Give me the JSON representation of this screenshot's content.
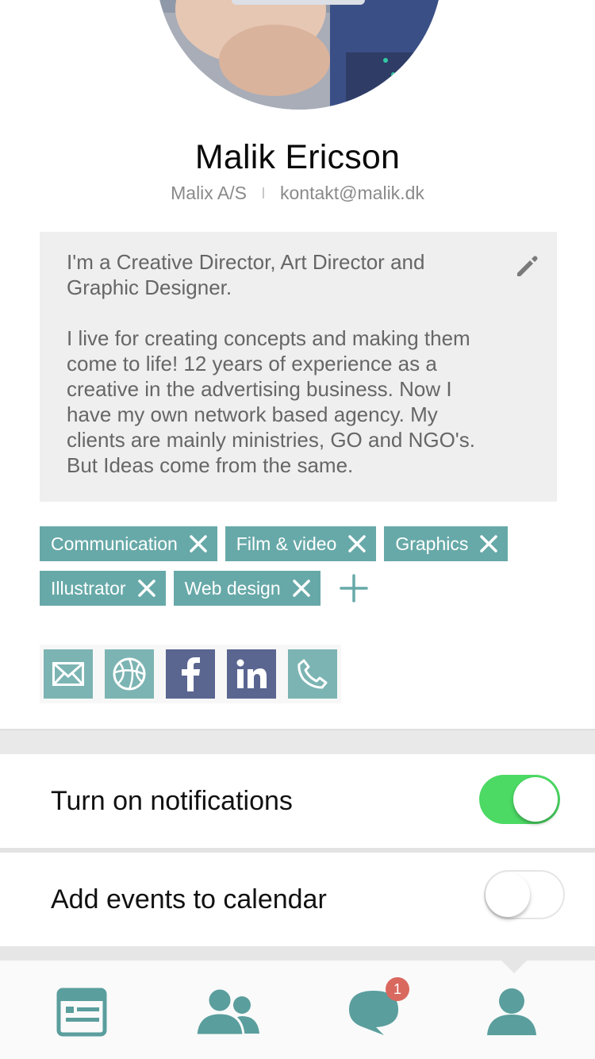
{
  "profile": {
    "name": "Malik Ericson",
    "company": "Malix A/S",
    "email": "kontakt@malik.dk",
    "bio": "I'm a Creative Director, Art Director and Graphic Designer.\n\nI live for creating concepts and making them come to life! 12 years of experience as a creative in the advertising business. Now I have my own network based agency. My clients are mainly ministries, GO and NGO's. But Ideas come from the same."
  },
  "tags": [
    {
      "label": "Communication"
    },
    {
      "label": "Film & video"
    },
    {
      "label": "Graphics"
    },
    {
      "label": "Illustrator"
    },
    {
      "label": "Web design"
    }
  ],
  "social_icons": [
    "mail-icon",
    "globe-icon",
    "facebook-icon",
    "linkedin-icon",
    "phone-icon"
  ],
  "settings": {
    "notifications_label": "Turn on notifications",
    "notifications_on": true,
    "calendar_label": "Add events to calendar",
    "calendar_on": false
  },
  "tabbar": {
    "items": [
      "news-icon",
      "people-icon",
      "chat-icon",
      "profile-icon"
    ],
    "chat_badge": "1",
    "active": "profile-icon"
  },
  "colors": {
    "accent": "#67a9a8",
    "social_teal": "#7cb4b3",
    "social_navy": "#5a6590",
    "toggle_on": "#4cd964",
    "badge": "#d9685f"
  }
}
